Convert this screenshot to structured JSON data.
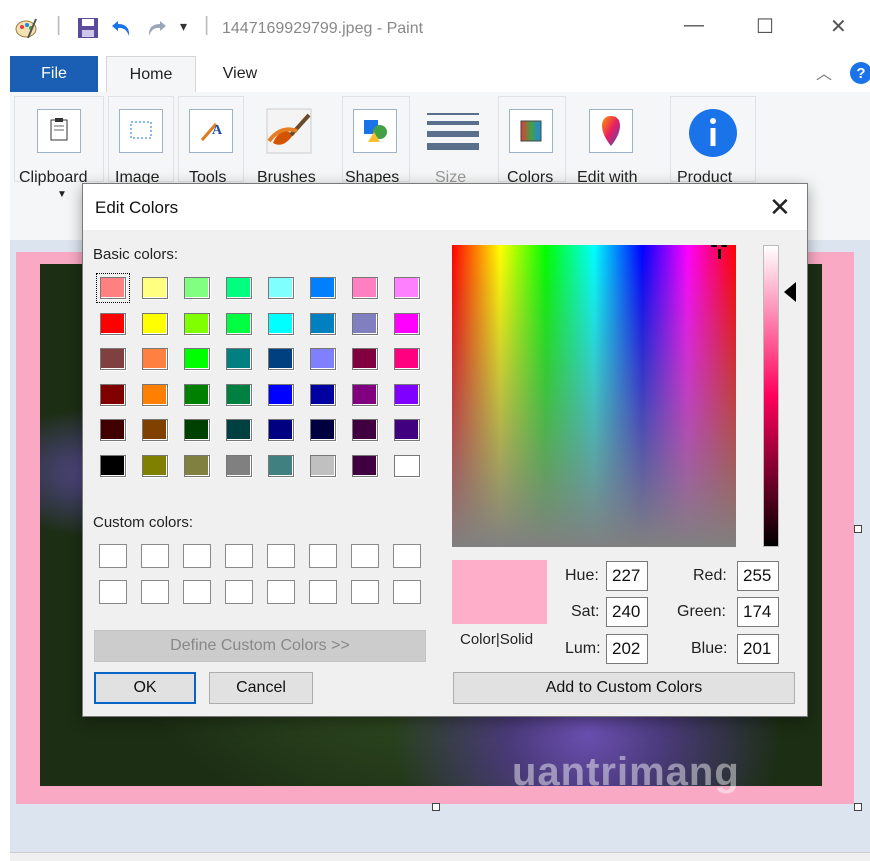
{
  "window": {
    "title": "1447169929799.jpeg - Paint",
    "minimize_glyph": "—",
    "maximize_glyph": "☐",
    "close_glyph": "✕"
  },
  "tabs": {
    "file": "File",
    "home": "Home",
    "view": "View"
  },
  "ribbon": {
    "groups": [
      "Clipboard",
      "Image",
      "Tools",
      "Brushes",
      "Shapes",
      "Size",
      "Colors",
      "Edit with",
      "Product"
    ]
  },
  "watermark": "uantrimang",
  "dialog": {
    "title": "Edit Colors",
    "basic_colors_label": "Basic colors:",
    "custom_colors_label": "Custom colors:",
    "define_button": "Define Custom Colors >>",
    "ok_button": "OK",
    "cancel_button": "Cancel",
    "add_button": "Add to Custom Colors",
    "color_solid_label": "Color|Solid",
    "hue_label": "Hue:",
    "sat_label": "Sat:",
    "lum_label": "Lum:",
    "red_label": "Red:",
    "green_label": "Green:",
    "blue_label": "Blue:",
    "hue": "227",
    "sat": "240",
    "lum": "202",
    "red": "255",
    "green": "174",
    "blue": "201",
    "preview_color": "#ffaec9",
    "basic_colors": [
      [
        "#ff8080",
        "#ffff80",
        "#80ff80",
        "#00ff80",
        "#80ffff",
        "#0080ff",
        "#ff80c0",
        "#ff80ff"
      ],
      [
        "#ff0000",
        "#ffff00",
        "#80ff00",
        "#00ff40",
        "#00ffff",
        "#0080c0",
        "#8080c0",
        "#ff00ff"
      ],
      [
        "#804040",
        "#ff8040",
        "#00ff00",
        "#008080",
        "#004080",
        "#8080ff",
        "#800040",
        "#ff0080"
      ],
      [
        "#800000",
        "#ff8000",
        "#008000",
        "#008040",
        "#0000ff",
        "#0000a0",
        "#800080",
        "#8000ff"
      ],
      [
        "#400000",
        "#804000",
        "#004000",
        "#004040",
        "#000080",
        "#000040",
        "#400040",
        "#400080"
      ],
      [
        "#000000",
        "#808000",
        "#808040",
        "#808080",
        "#408080",
        "#c0c0c0",
        "#400040",
        "#ffffff"
      ]
    ]
  }
}
